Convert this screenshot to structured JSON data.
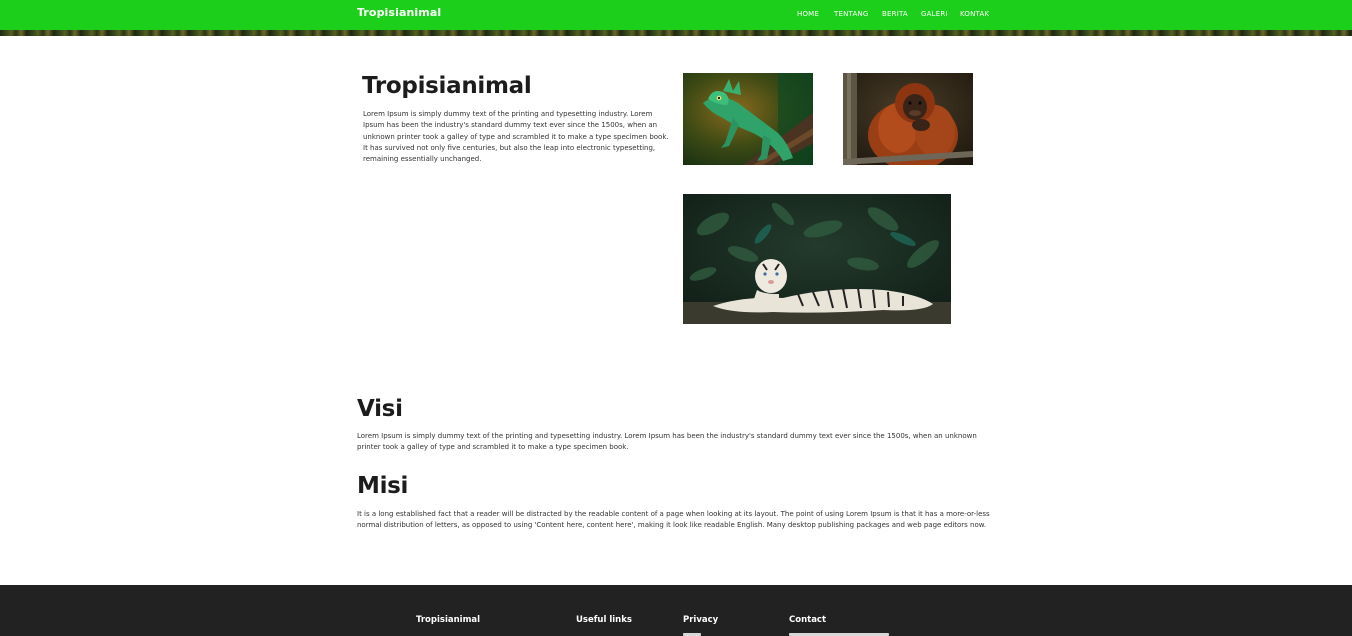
{
  "header": {
    "brand": "Tropisianimal",
    "nav": [
      "HOME",
      "TENTANG",
      "BERITA",
      "GALERI",
      "KONTAK"
    ]
  },
  "hero": {
    "title": "Tropisianimal",
    "text": "Lorem Ipsum is simply dummy text of the printing and typesetting industry. Lorem Ipsum has been the industry's standard dummy text ever since the 1500s, when an unknown printer took a galley of type and scrambled it to make a type specimen book. It has survived not only five centuries, but also the leap into electronic typesetting, remaining essentially unchanged."
  },
  "gallery": {
    "images": [
      "lizard-photo",
      "orangutan-photo",
      "white-tiger-photo"
    ]
  },
  "visi": {
    "title": "Visi",
    "text": "Lorem Ipsum is simply dummy text of the printing and typesetting industry. Lorem Ipsum has been the industry's standard dummy text ever since the 1500s, when an unknown printer took a galley of type and scrambled it to make a type specimen book."
  },
  "misi": {
    "title": "Misi",
    "text": "It is a long established fact that a reader will be distracted by the readable content of a page when looking at its layout. The point of using Lorem Ipsum is that it has a more-or-less normal distribution of letters, as opposed to using 'Content here, content here', making it look like readable English. Many desktop publishing packages and web page editors now."
  },
  "footer": {
    "columns": [
      "Tropisianimal",
      "Useful links",
      "Privacy",
      "Contact"
    ]
  },
  "colors": {
    "navbar": "#1ccf1a",
    "footer": "#222222",
    "heading": "#1c1c1c"
  }
}
